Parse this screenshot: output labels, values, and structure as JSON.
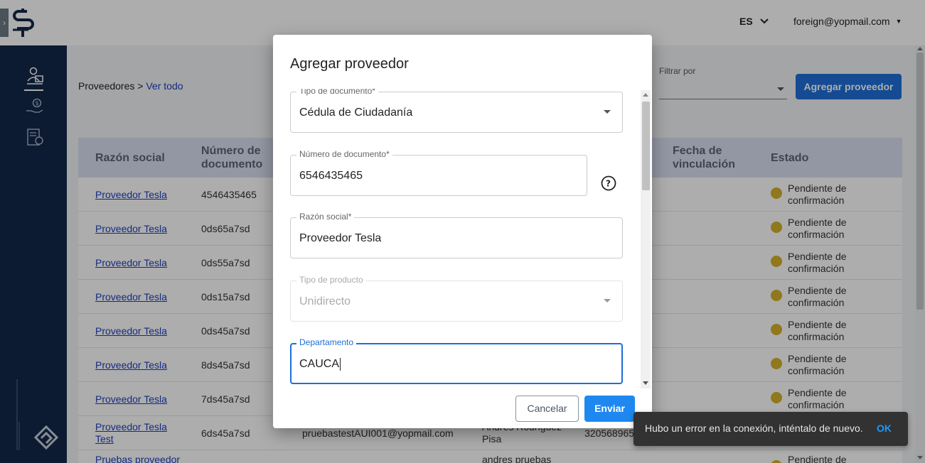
{
  "header": {
    "language": "ES",
    "user_email": "foreign@yopmail.com"
  },
  "breadcrumb": {
    "section": "Proveedores",
    "separator": " > ",
    "current": "Ver todo"
  },
  "toolbar": {
    "filter_label": "Filtrar por",
    "filter_value": "",
    "add_button": "Agregar proveedor"
  },
  "table": {
    "columns": [
      "Razón social",
      "Número de documento",
      "",
      "",
      "Fecha de vinculación",
      "Estado"
    ],
    "rows": [
      {
        "name": "Proveedor Tesla",
        "doc": "4546435465",
        "email": "",
        "contact": "",
        "phone": "",
        "status": "Pendiente de confirmación"
      },
      {
        "name": "Proveedor Tesla",
        "doc": "0ds65a7sd",
        "email": "",
        "contact": "",
        "phone": "",
        "status": "Pendiente de confirmación"
      },
      {
        "name": "Proveedor Tesla",
        "doc": "0ds55a7sd",
        "email": "",
        "contact": "",
        "phone": "",
        "status": "Pendiente de confirmación"
      },
      {
        "name": "Proveedor Tesla",
        "doc": "0ds15a7sd",
        "email": "",
        "contact": "",
        "phone": "",
        "status": "Pendiente de confirmación"
      },
      {
        "name": "Proveedor Tesla",
        "doc": "0ds45a7sd",
        "email": "",
        "contact": "",
        "phone": "",
        "status": "Pendiente de confirmación"
      },
      {
        "name": "Proveedor Tesla",
        "doc": "8ds45a7sd",
        "email": "",
        "contact": "",
        "phone": "",
        "status": "Pendiente de confirmación"
      },
      {
        "name": "Proveedor Tesla",
        "doc": "7ds45a7sd",
        "email": "",
        "contact": "",
        "phone": "",
        "status": "Pendiente de confirmación"
      },
      {
        "name": "Proveedor Tesla Test",
        "doc": "6ds45a7sd",
        "email": "pruebastestAUI001@yopmail.com",
        "contact": "Andres Rodriguez Pisa",
        "phone": "320568965",
        "status": ""
      },
      {
        "name": "Pruebas proveedor",
        "doc": "",
        "email": "",
        "contact": "andres pruebas",
        "phone": "",
        "status": "Pendiente de"
      }
    ],
    "status_color": "#d4b12a"
  },
  "modal": {
    "title": "Agregar proveedor",
    "fields": {
      "doc_type": {
        "label": "Tipo de documento*",
        "value": "Cédula de Ciudadanía"
      },
      "doc_number": {
        "label": "Número de documento*",
        "value": "6546435465"
      },
      "business_name": {
        "label": "Razón social*",
        "value": "Proveedor Tesla"
      },
      "product_type": {
        "label": "Tipo de producto",
        "value": "Unidirecto"
      },
      "department": {
        "label": "Departamento",
        "value": "CAUCA"
      }
    },
    "cancel": "Cancelar",
    "submit": "Enviar"
  },
  "snackbar": {
    "message": "Hubo un error en la conexión, inténtalo de nuevo.",
    "action": "OK"
  },
  "colors": {
    "sidebar": "#14284b",
    "primary": "#1e6fd9",
    "link": "#1e3fbf"
  }
}
